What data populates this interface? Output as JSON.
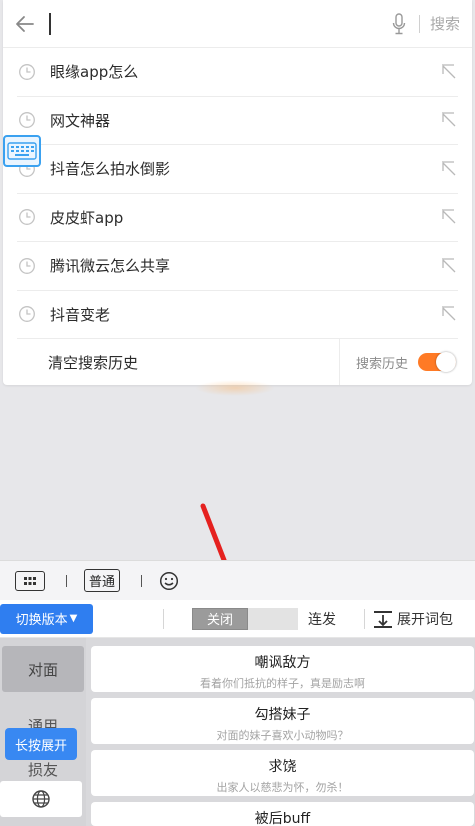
{
  "search": {
    "back_icon": "arrow-left-icon",
    "mic_icon": "microphone-icon",
    "search_label": "搜索"
  },
  "history": {
    "items": [
      {
        "text": "眼缘app怎么"
      },
      {
        "text": "网文神器"
      },
      {
        "text": "抖音怎么拍水倒影"
      },
      {
        "text": "皮皮虾app"
      },
      {
        "text": "腾讯微云怎么共享"
      },
      {
        "text": "抖音变老"
      }
    ],
    "clear_label": "清空搜索历史",
    "toggle_label": "搜索历史",
    "toggle_on": true
  },
  "keyboard": {
    "mode_label": "普通",
    "switch_version_label": "切换版本",
    "close_label": "关闭",
    "lianfa_label": "连发",
    "expand_words_label": "展开词包",
    "categories": [
      "对面",
      "通用",
      "损友"
    ],
    "long_press_label": "长按展开",
    "phrases": [
      {
        "title": "嘲讽敌方",
        "sub": "看着你们抵抗的样子，真是励志啊"
      },
      {
        "title": "勾搭妹子",
        "sub": "对面的妹子喜欢小动物吗？"
      },
      {
        "title": "求饶",
        "sub": "出家人以慈悲为怀，勿杀！"
      },
      {
        "title": "被后buff",
        "sub": ""
      }
    ]
  },
  "colors": {
    "accent_orange": "#ff7a25",
    "accent_blue": "#2f7ef0",
    "arrow_red": "#e5211f"
  }
}
